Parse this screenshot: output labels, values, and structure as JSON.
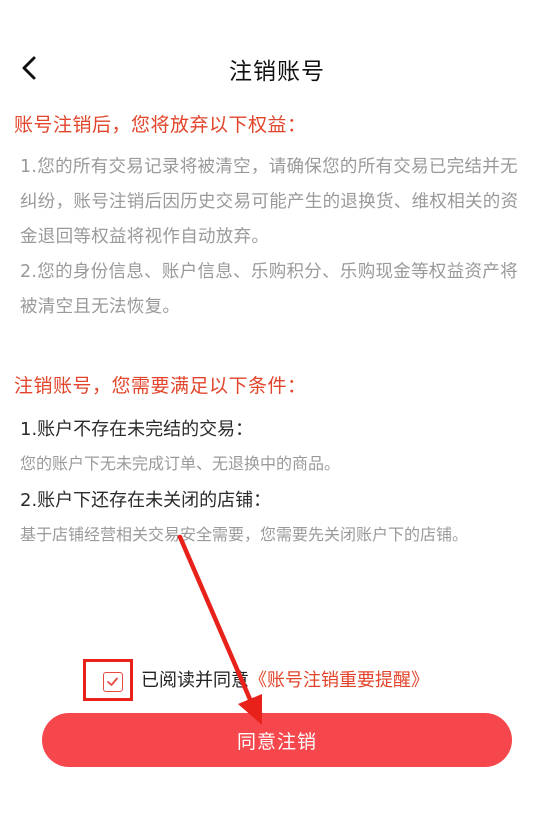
{
  "header": {
    "title": "注销账号"
  },
  "section1": {
    "title": "账号注销后，您将放弃以下权益：",
    "item1": "1.您的所有交易记录将被清空，请确保您的所有交易已完结并无纠纷，账号注销后因历史交易可能产生的退换货、维权相关的资金退回等权益将视作自动放弃。",
    "item2": "2.您的身份信息、账户信息、乐购积分、乐购现金等权益资产将被清空且无法恢复。"
  },
  "section2": {
    "title": "注销账号，您需要满足以下条件：",
    "cond1_title": "1.账户不存在未完结的交易：",
    "cond1_desc": "您的账户下无未完成订单、无退换中的商品。",
    "cond2_title": "2.账户下还存在未关闭的店铺：",
    "cond2_desc": "基于店铺经营相关交易安全需要，您需要先关闭账户下的店铺。"
  },
  "agreement": {
    "text": "已阅读并同意",
    "link": "《账号注销重要提醒》",
    "checked": true
  },
  "confirm_button": {
    "label": "同意注销"
  },
  "colors": {
    "accent": "#e2452b",
    "button": "#f6474c",
    "annotation": "#e8211a"
  }
}
